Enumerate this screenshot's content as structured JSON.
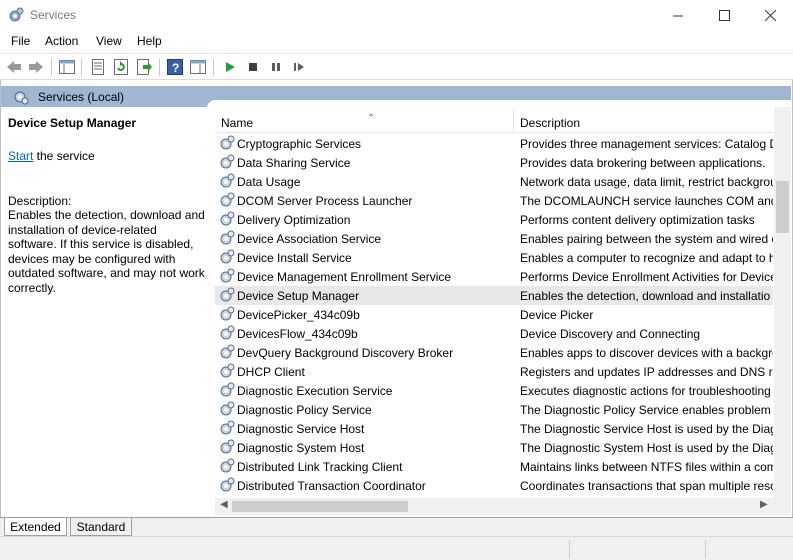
{
  "window": {
    "title": "Services"
  },
  "menu": [
    "File",
    "Action",
    "View",
    "Help"
  ],
  "scope": {
    "label": "Services (Local)"
  },
  "details": {
    "title": "Device Setup Manager",
    "start_link": "Start",
    "start_suffix": " the service",
    "description_label": "Description:",
    "description": "Enables the detection, download and installation of device-related software. If this service is disabled, devices may be configured with outdated software, and may not work correctly."
  },
  "columns": {
    "name": "Name",
    "description": "Description"
  },
  "services": [
    {
      "name": "Cryptographic Services",
      "description": "Provides three management services: Catalog Da"
    },
    {
      "name": "Data Sharing Service",
      "description": "Provides data brokering between applications."
    },
    {
      "name": "Data Usage",
      "description": "Network data usage, data limit, restrict backgrou"
    },
    {
      "name": "DCOM Server Process Launcher",
      "description": "The DCOMLAUNCH service launches COM and"
    },
    {
      "name": "Delivery Optimization",
      "description": "Performs content delivery optimization tasks"
    },
    {
      "name": "Device Association Service",
      "description": "Enables pairing between the system and wired o"
    },
    {
      "name": "Device Install Service",
      "description": "Enables a computer to recognize and adapt to h"
    },
    {
      "name": "Device Management Enrollment Service",
      "description": "Performs Device Enrollment Activities for Device"
    },
    {
      "name": "Device Setup Manager",
      "description": "Enables the detection, download and installatio",
      "selected": true
    },
    {
      "name": "DevicePicker_434c09b",
      "description": "Device Picker"
    },
    {
      "name": "DevicesFlow_434c09b",
      "description": "Device Discovery and Connecting"
    },
    {
      "name": "DevQuery Background Discovery Broker",
      "description": "Enables apps to discover devices with a backgro"
    },
    {
      "name": "DHCP Client",
      "description": "Registers and updates IP addresses and DNS reco"
    },
    {
      "name": "Diagnostic Execution Service",
      "description": "Executes diagnostic actions for troubleshooting"
    },
    {
      "name": "Diagnostic Policy Service",
      "description": "The Diagnostic Policy Service enables problem d"
    },
    {
      "name": "Diagnostic Service Host",
      "description": "The Diagnostic Service Host is used by the Diagn"
    },
    {
      "name": "Diagnostic System Host",
      "description": "The Diagnostic System Host is used by the Diagn"
    },
    {
      "name": "Distributed Link Tracking Client",
      "description": "Maintains links between NTFS files within a com"
    },
    {
      "name": "Distributed Transaction Coordinator",
      "description": "Coordinates transactions that span multiple reso"
    }
  ],
  "tabs": [
    "Extended",
    "Standard"
  ],
  "toolbar_icons": [
    "back-icon",
    "forward-icon",
    "show-hide-console-tree-icon",
    "properties-icon",
    "refresh-icon",
    "export-list-icon",
    "help-icon",
    "show-action-pane-icon",
    "start-service-icon",
    "stop-service-icon",
    "pause-service-icon",
    "resume-service-icon"
  ],
  "colors": {
    "scope_band": "#9fb7d2",
    "link": "#0066cc",
    "selected_row": "#e8e8e8"
  }
}
